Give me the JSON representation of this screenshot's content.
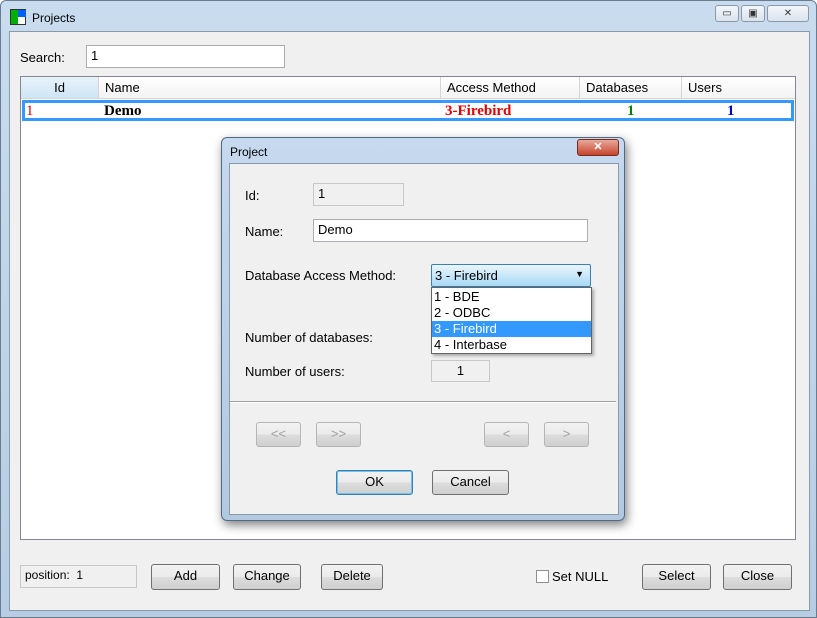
{
  "window": {
    "title": "Projects"
  },
  "search": {
    "label": "Search:",
    "value": "1"
  },
  "grid": {
    "columns": [
      "Id",
      "Name",
      "Access Method",
      "Databases",
      "Users"
    ],
    "rows": [
      {
        "id": "1",
        "name": "Demo",
        "access": "3-Firebird",
        "databases": "1",
        "users": "1"
      }
    ]
  },
  "footer": {
    "position_label": "position:",
    "position_value": "1",
    "add": "Add",
    "change": "Change",
    "delete": "Delete",
    "set_null": "Set NULL",
    "select": "Select",
    "close": "Close"
  },
  "dialog": {
    "title": "Project",
    "id_label": "Id:",
    "id_value": "1",
    "name_label": "Name:",
    "name_value": "Demo",
    "access_label": "Database Access Method:",
    "access_value": "3 - Firebird",
    "access_options": [
      "1 - BDE",
      "2 - ODBC",
      "3 - Firebird",
      "4 - Interbase"
    ],
    "db_label": "Number of databases:",
    "users_label": "Number of users:",
    "users_value": "1",
    "first": "<<",
    "last": ">>",
    "prev": "<",
    "next": ">",
    "ok": "OK",
    "cancel": "Cancel"
  },
  "colors": {
    "id": "#e00000",
    "access": "#e00000",
    "databases": "#008000",
    "users": "#0000c0",
    "selection": "#3399ff"
  }
}
